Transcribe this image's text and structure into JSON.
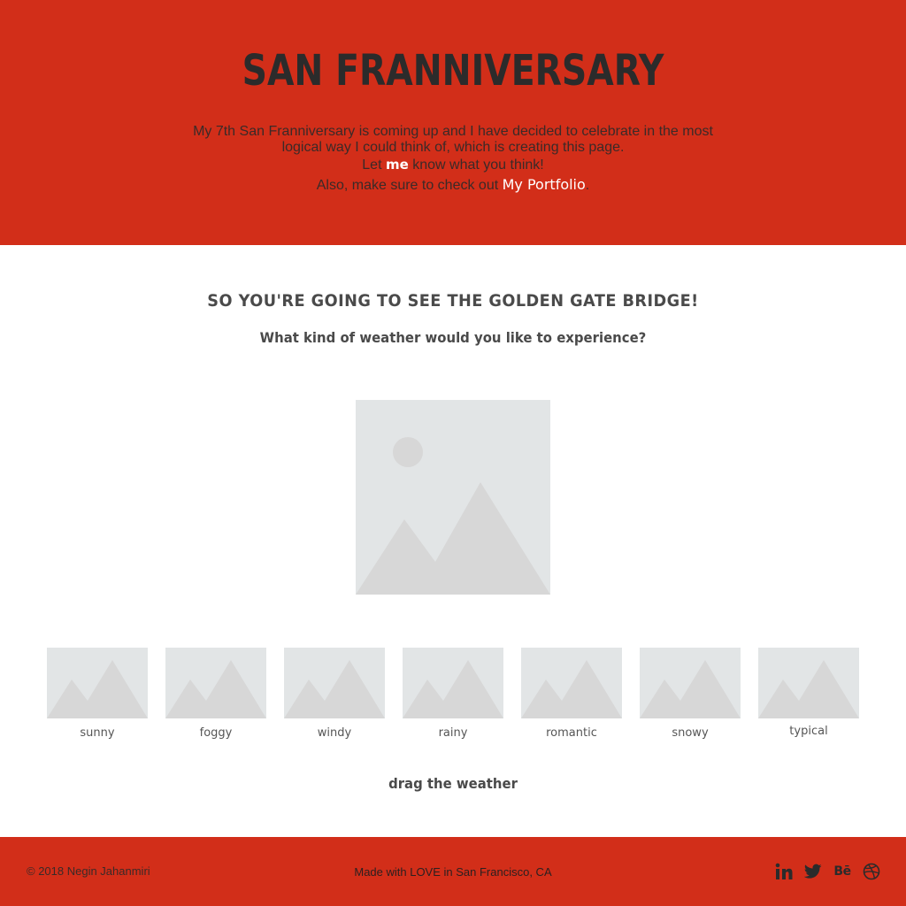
{
  "header": {
    "title": "SAN FRANNIVERSARY",
    "intro_line1": "My 7th San Franniversary is coming up and I have decided to celebrate in the most",
    "intro_line2": "logical way I could think of, which is creating this page.",
    "let_prefix": "Let ",
    "me_link": "me",
    "let_suffix": " know what you think!",
    "portfolio_prefix": "Also, make sure to check out ",
    "portfolio_link": "My Portfolio",
    "portfolio_suffix": "."
  },
  "main": {
    "heading": "SO YOU'RE GOING TO SEE THE GOLDEN GATE BRIDGE!",
    "subheading": "What kind of weather would you like to experience?",
    "drag_hint": "drag the weather"
  },
  "weather_options": [
    {
      "label": "sunny"
    },
    {
      "label": "foggy"
    },
    {
      "label": "windy"
    },
    {
      "label": "rainy"
    },
    {
      "label": "romantic"
    },
    {
      "label": "snowy"
    },
    {
      "label": "typical"
    }
  ],
  "footer": {
    "copyright": "© 2018 Negin Jahanmiri",
    "made_with": "Made with LOVE in San Francisco, CA",
    "social": [
      {
        "name": "linkedin-icon"
      },
      {
        "name": "twitter-icon"
      },
      {
        "name": "behance-icon",
        "text": "Bē"
      },
      {
        "name": "dribbble-icon"
      }
    ]
  },
  "colors": {
    "brand_red": "#d22e19",
    "placeholder_bg": "#e2e5e6",
    "placeholder_shape": "#d7d7d7",
    "text_dark": "#4a4a4a"
  }
}
